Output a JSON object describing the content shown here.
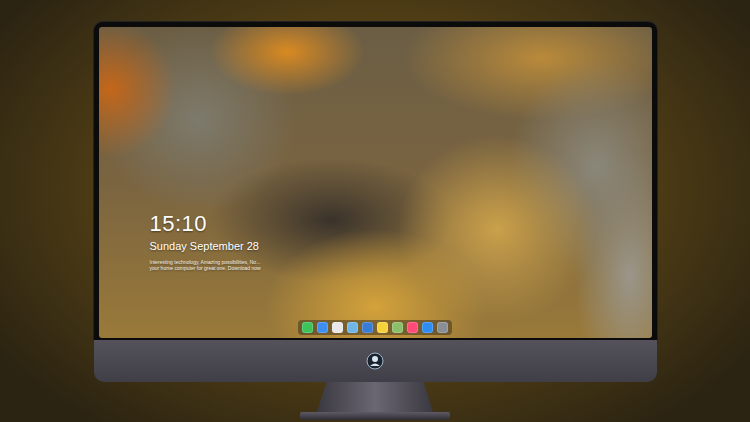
{
  "clock": {
    "time": "15:10",
    "date": "Sunday September 28",
    "caption": [
      "Interesting technology, Amazing possibilities, No...",
      "your home computer for great one. Download now"
    ]
  },
  "dock": {
    "apps": [
      {
        "color": "#3dc35a"
      },
      {
        "color": "#3d8ef0"
      },
      {
        "color": "#e8e8e8"
      },
      {
        "color": "#6fb6e8"
      },
      {
        "color": "#3a7bd5"
      },
      {
        "color": "#f5d23c"
      },
      {
        "color": "#8bbf6a"
      },
      {
        "color": "#ff4a7a"
      },
      {
        "color": "#2f8cf3"
      },
      {
        "color": "#8a8f96"
      }
    ]
  }
}
